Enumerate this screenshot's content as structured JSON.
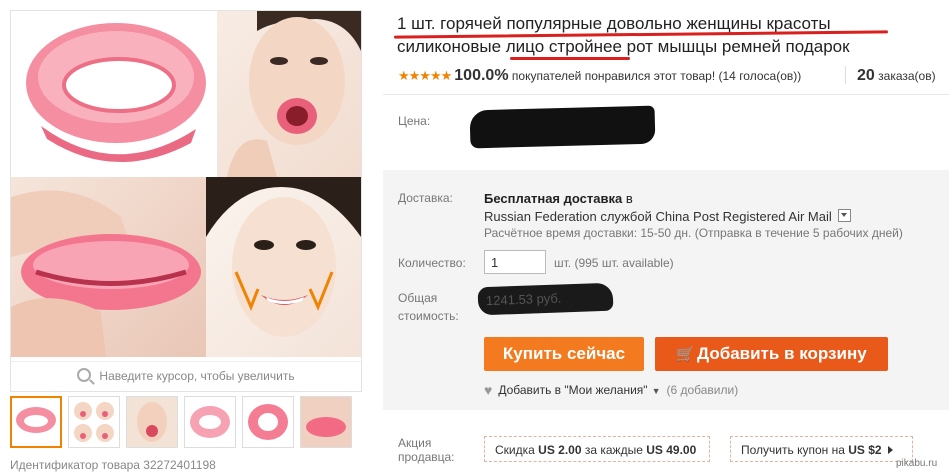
{
  "gallery": {
    "zoom_hint": "Наведите курсор, чтобы увеличить",
    "product_id": "Идентификатор товара 32272401198",
    "thumbnail_count": 6,
    "active_thumbnail": 1
  },
  "product": {
    "title_line1": "1 шт. горячей популярные довольно женщины красоты",
    "title_line2": "силиконовые лицо стройнее рот мышцы ремней подарок"
  },
  "rating": {
    "stars": "★★★★★",
    "percent": "100.0%",
    "text": "покупателей понравился этот товар! (14 голоса(ов))",
    "orders_count": "20",
    "orders_label": "заказа(ов)"
  },
  "price": {
    "label": "Цена:"
  },
  "shipping": {
    "label": "Доставка:",
    "free": "Бесплатная доставка",
    "in": "в",
    "method": "Russian Federation службой China Post Registered Air Mail",
    "time": "Расчётное время доставки: 15-50 дн. (Отправка в течение 5 рабочих дней)"
  },
  "quantity": {
    "label": "Количество:",
    "value": "1",
    "unit": "шт. (995 шт. available)"
  },
  "total": {
    "label_line1": "Общая",
    "label_line2": "стоимость:",
    "value": "1241.53 руб."
  },
  "buttons": {
    "buy_now": "Купить сейчас",
    "add_to_cart": "Добавить в корзину",
    "cart_icon": "🛒"
  },
  "wishlist": {
    "label": "Добавить в \"Мои желания\"",
    "count": "(6 добавили)"
  },
  "promo": {
    "label_line1": "Акция",
    "label_line2": "продавца:",
    "discount_text": "Скидка",
    "discount_amount": "US 2.00",
    "discount_mid": "за каждые",
    "discount_threshold": "US 49.00",
    "coupon_text": "Получить купон на",
    "coupon_amount": "US $2"
  },
  "watermark": "pikabu.ru",
  "colors": {
    "accent_orange": "#f47a1f",
    "cart_orange": "#e8591a",
    "underline_red": "#d9201f",
    "star": "#f08300"
  }
}
